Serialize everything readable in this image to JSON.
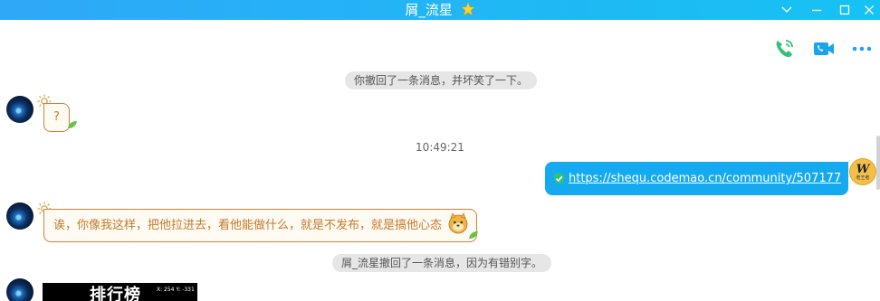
{
  "window": {
    "title": "屑_流星",
    "title_icon": "star-icon"
  },
  "toolbar": {
    "icons": [
      "voice-call-icon",
      "video-call-icon",
      "more-icon"
    ]
  },
  "messages": {
    "system_1": "你撤回了一条消息，并坏笑了一下。",
    "left_1": "?",
    "timestamp": "10:49:21",
    "right_1_link": "https://shequ.codemao.cn/community/507177",
    "left_2": "诶，你像我这样，把他拉进去，看他能做什么，就是不发布，就是搞他心态",
    "system_2": "屑_流星撤回了一条消息，因为有错别字。",
    "image_title": "排行榜",
    "image_coords": "X: 254   Y: -331"
  },
  "avatar_w": {
    "letter": "W",
    "caption": "老王者"
  },
  "colors": {
    "titlebar": "#1fb4f5",
    "bubble_self": "#15aaf0",
    "bubble_other_border": "#c9853f",
    "bubble_other_text": "#c47a2c",
    "call_green": "#2fc37a",
    "video_blue": "#1aa4f0"
  }
}
